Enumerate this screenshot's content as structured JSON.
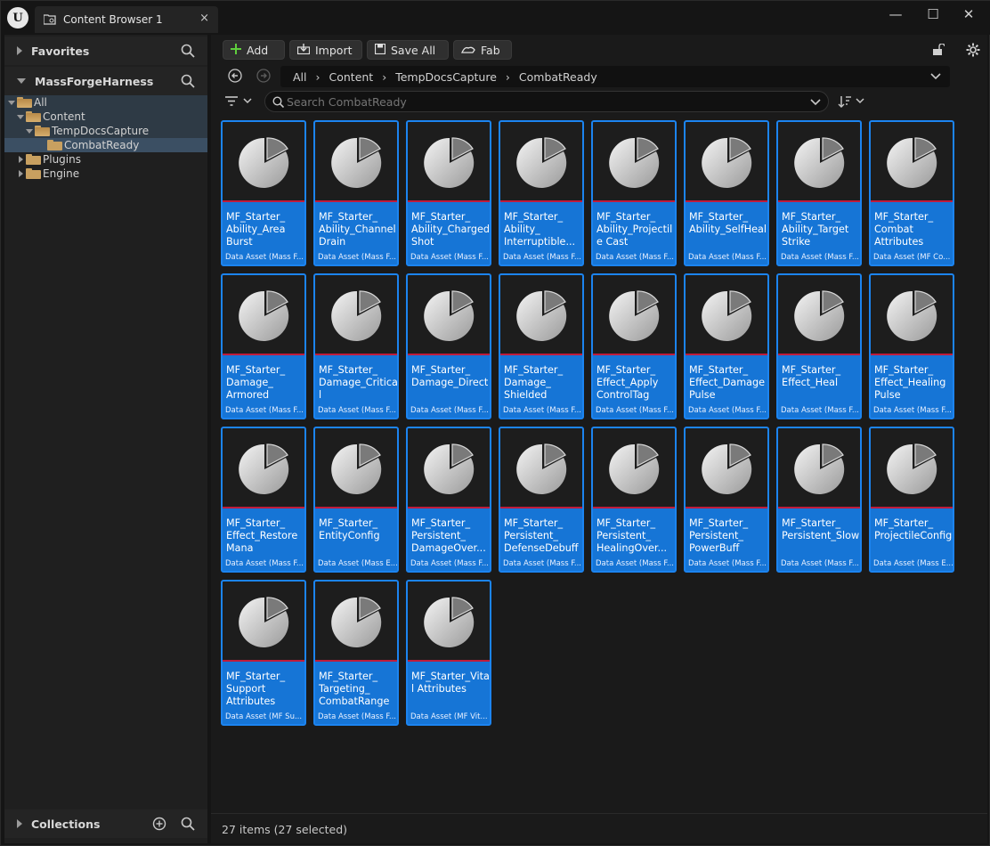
{
  "window": {
    "tab_title": "Content Browser 1",
    "close_glyph": "×",
    "min_glyph": "—",
    "max_glyph": "☐",
    "wclose_glyph": "✕"
  },
  "sidebar": {
    "favorites_label": "Favorites",
    "project_label": "MassForgeHarness",
    "collections_label": "Collections",
    "tree": [
      {
        "label": "All"
      },
      {
        "label": "Content"
      },
      {
        "label": "TempDocsCapture"
      },
      {
        "label": "CombatReady"
      },
      {
        "label": "Plugins"
      },
      {
        "label": "Engine"
      }
    ]
  },
  "toolbar": {
    "add_label": "Add",
    "import_label": "Import",
    "saveall_label": "Save All",
    "fab_label": "Fab"
  },
  "breadcrumb": [
    "All",
    "Content",
    "TempDocsCapture",
    "CombatReady"
  ],
  "search": {
    "placeholder": "Search CombatReady"
  },
  "assets": [
    {
      "name": "MF_Starter_ Ability_Area Burst",
      "type": "Data Asset (Mass F..."
    },
    {
      "name": "MF_Starter_ Ability_Channel Drain",
      "type": "Data Asset (Mass F..."
    },
    {
      "name": "MF_Starter_ Ability_Charged Shot",
      "type": "Data Asset (Mass F..."
    },
    {
      "name": "MF_Starter_ Ability_ Interruptible...",
      "type": "Data Asset (Mass F..."
    },
    {
      "name": "MF_Starter_ Ability_Projectile Cast",
      "type": "Data Asset (Mass F..."
    },
    {
      "name": "MF_Starter_ Ability_SelfHeal",
      "type": "Data Asset (Mass F..."
    },
    {
      "name": "MF_Starter_ Ability_Target Strike",
      "type": "Data Asset (Mass F..."
    },
    {
      "name": "MF_Starter_ Combat Attributes",
      "type": "Data Asset (MF Co..."
    },
    {
      "name": "MF_Starter_ Damage_ Armored",
      "type": "Data Asset (Mass F..."
    },
    {
      "name": "MF_Starter_ Damage_Critical",
      "type": "Data Asset (Mass F..."
    },
    {
      "name": "MF_Starter_ Damage_Direct",
      "type": "Data Asset (Mass F..."
    },
    {
      "name": "MF_Starter_ Damage_ Shielded",
      "type": "Data Asset (Mass F..."
    },
    {
      "name": "MF_Starter_ Effect_Apply ControlTag",
      "type": "Data Asset (Mass F..."
    },
    {
      "name": "MF_Starter_ Effect_Damage Pulse",
      "type": "Data Asset (Mass F..."
    },
    {
      "name": "MF_Starter_ Effect_Heal",
      "type": "Data Asset (Mass F..."
    },
    {
      "name": "MF_Starter_ Effect_Healing Pulse",
      "type": "Data Asset (Mass F..."
    },
    {
      "name": "MF_Starter_ Effect_Restore Mana",
      "type": "Data Asset (Mass F..."
    },
    {
      "name": "MF_Starter_ EntityConfig",
      "type": "Data Asset (Mass E..."
    },
    {
      "name": "MF_Starter_ Persistent_ DamageOver...",
      "type": "Data Asset (Mass F..."
    },
    {
      "name": "MF_Starter_ Persistent_ DefenseDebuff",
      "type": "Data Asset (Mass F..."
    },
    {
      "name": "MF_Starter_ Persistent_ HealingOver...",
      "type": "Data Asset (Mass F..."
    },
    {
      "name": "MF_Starter_ Persistent_ PowerBuff",
      "type": "Data Asset (Mass F..."
    },
    {
      "name": "MF_Starter_ Persistent_Slow",
      "type": "Data Asset (Mass F..."
    },
    {
      "name": "MF_Starter_ ProjectileConfig",
      "type": "Data Asset (Mass E..."
    },
    {
      "name": "MF_Starter_ Support Attributes",
      "type": "Data Asset (MF Su..."
    },
    {
      "name": "MF_Starter_ Targeting_ CombatRange",
      "type": "Data Asset (Mass F..."
    },
    {
      "name": "MF_Starter_Vital Attributes",
      "type": "Data Asset (MF Vit..."
    }
  ],
  "status": {
    "text": "27 items (27 selected)"
  },
  "colors": {
    "accent": "#1675d6",
    "tile_border": "#1c84f0",
    "asset_stripe": "#c01c3c"
  }
}
